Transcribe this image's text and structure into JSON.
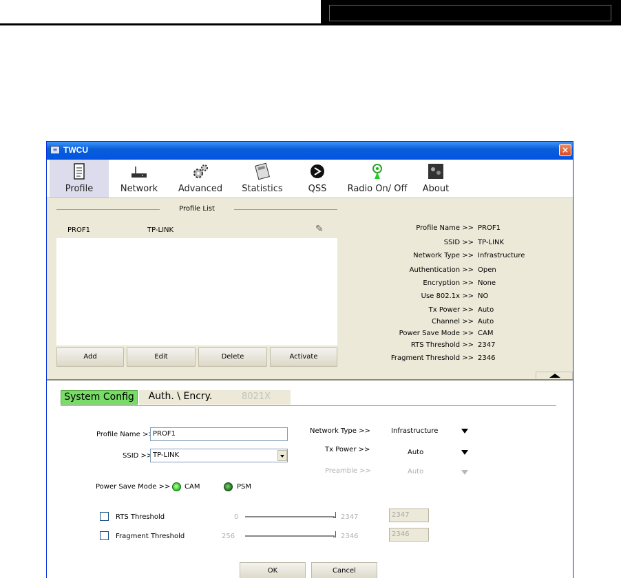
{
  "window": {
    "title": "TWCU",
    "close": "×"
  },
  "toolbar": {
    "profile": "Profile",
    "network": "Network",
    "advanced": "Advanced",
    "statistics": "Statistics",
    "qss": "QSS",
    "radio": "Radio On/ Off",
    "about": "About"
  },
  "profile_list": {
    "title": "Profile List",
    "rows": [
      {
        "name": "PROF1",
        "ssid": "TP-LINK"
      }
    ],
    "buttons": {
      "add": "Add",
      "edit": "Edit",
      "delete": "Delete",
      "activate": "Activate"
    }
  },
  "info": {
    "profile_name": {
      "label": "Profile Name >>",
      "value": "PROF1"
    },
    "ssid": {
      "label": "SSID >>",
      "value": "TP-LINK"
    },
    "network_type": {
      "label": "Network Type >>",
      "value": "Infrastructure"
    },
    "authentication": {
      "label": "Authentication >>",
      "value": "Open"
    },
    "encryption": {
      "label": "Encryption >>",
      "value": "None"
    },
    "use8021x": {
      "label": "Use 802.1x >>",
      "value": "NO"
    },
    "tx_power": {
      "label": "Tx Power >>",
      "value": "Auto"
    },
    "channel": {
      "label": "Channel >>",
      "value": "Auto"
    },
    "power_save": {
      "label": "Power Save Mode >>",
      "value": "CAM"
    },
    "rts": {
      "label": "RTS Threshold >>",
      "value": "2347"
    },
    "fragment": {
      "label": "Fragment Threshold >>",
      "value": "2346"
    }
  },
  "tabs": {
    "system_config": "System Config",
    "auth": "Auth. \\ Encry.",
    "x8021": "8021X"
  },
  "config": {
    "profile_name_label": "Profile Name >>",
    "profile_name_value": "PROF1",
    "ssid_label": "SSID >>",
    "ssid_value": "TP-LINK",
    "network_type_label": "Network Type >>",
    "network_type_value": "Infrastructure",
    "tx_power_label": "Tx Power >>",
    "tx_power_value": "Auto",
    "preamble_label": "Preamble >>",
    "preamble_value": "Auto",
    "power_save_label": "Power Save Mode >>",
    "cam": "CAM",
    "psm": "PSM",
    "rts_label": "RTS Threshold",
    "rts_min": "0",
    "rts_max": "2347",
    "rts_value": "2347",
    "frag_label": "Fragment Threshold",
    "frag_min": "256",
    "frag_max": "2346",
    "frag_value": "2346"
  },
  "footer": {
    "ok": "OK",
    "cancel": "Cancel"
  }
}
